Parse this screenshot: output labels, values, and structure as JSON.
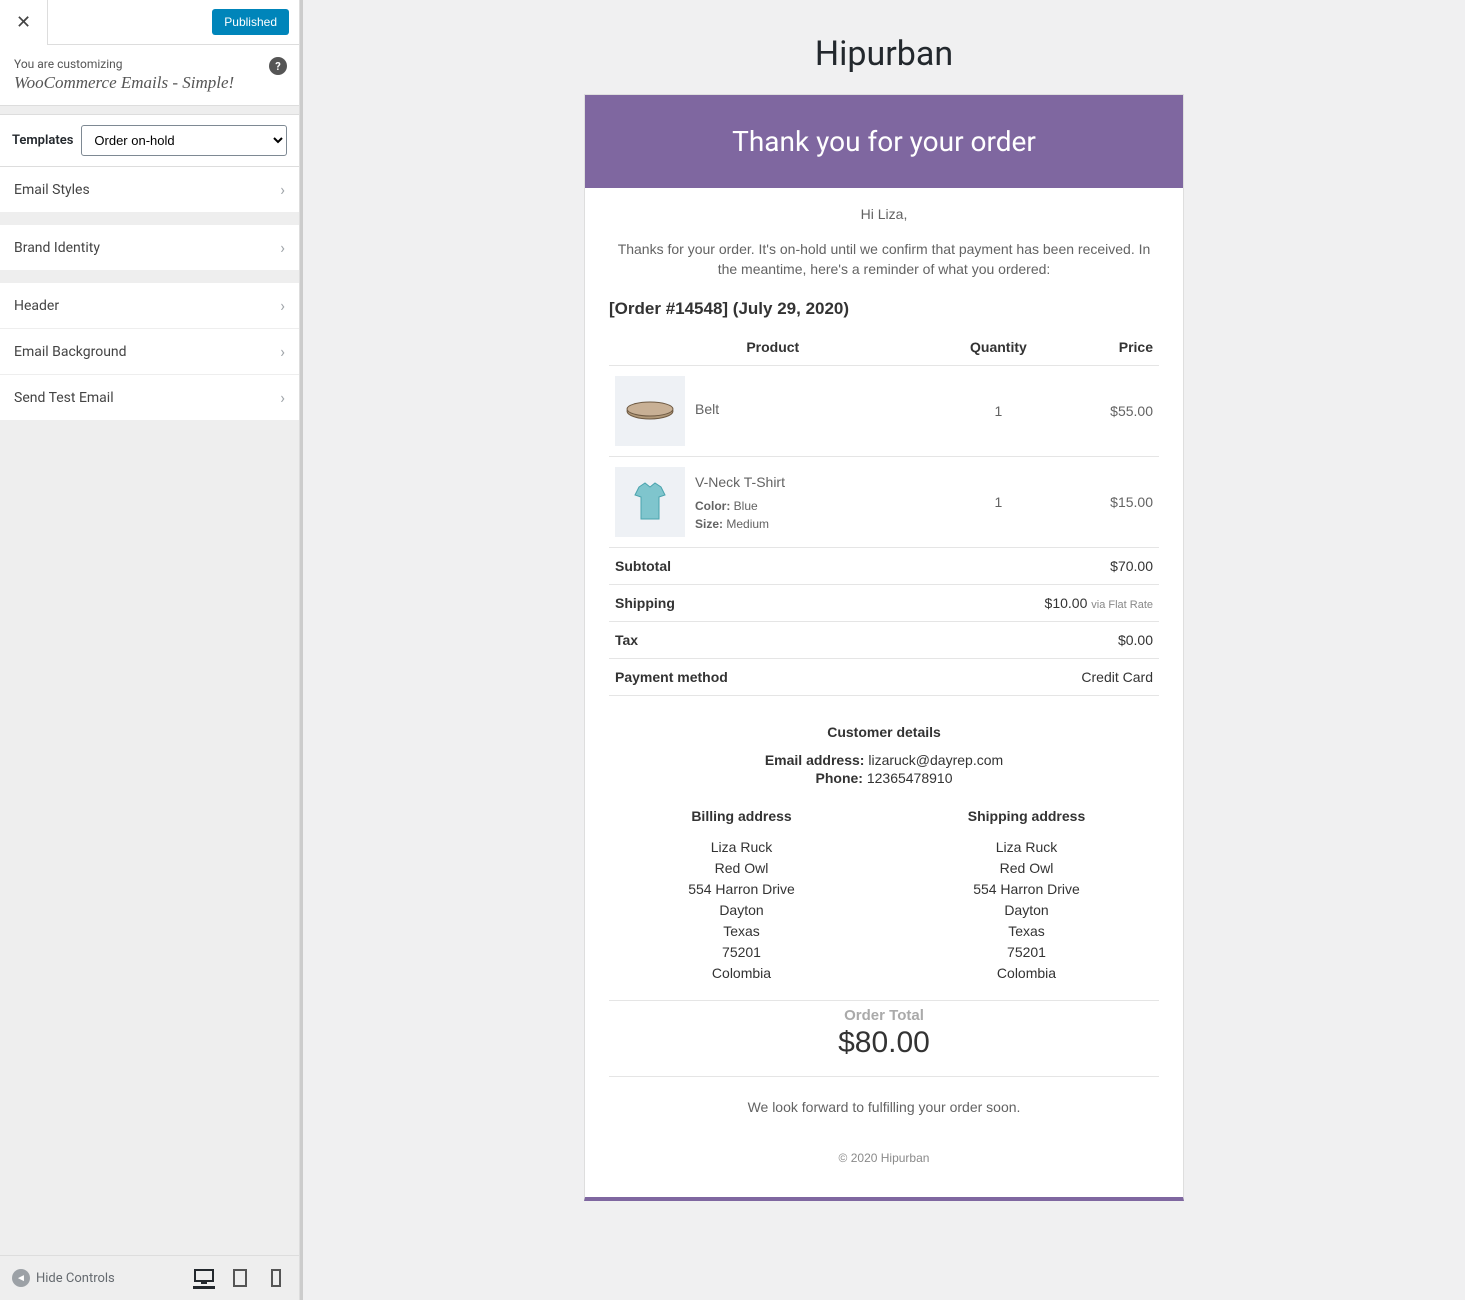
{
  "sidebar": {
    "published_label": "Published",
    "customizing_label": "You are customizing",
    "title": "WooCommerce Emails - Simple!",
    "templates_label": "Templates",
    "template_selected": "Order on-hold",
    "menu": [
      "Email Styles",
      "Brand Identity",
      "Header",
      "Email Background",
      "Send Test Email"
    ],
    "hide_controls": "Hide Controls"
  },
  "preview": {
    "brand": "Hipurban",
    "header": "Thank you for your order",
    "greeting": "Hi Liza,",
    "intro": "Thanks for your order. It's on-hold until we confirm that payment has been received. In the meantime, here's a reminder of what you ordered:",
    "order_number": "#14548",
    "order_date": "July 29, 2020",
    "columns": {
      "product": "Product",
      "quantity": "Quantity",
      "price": "Price"
    },
    "items": [
      {
        "name": "Belt",
        "qty": "1",
        "price": "$55.00",
        "attrs": []
      },
      {
        "name": "V-Neck T-Shirt",
        "qty": "1",
        "price": "$15.00",
        "attrs": [
          {
            "label": "Color:",
            "value": "Blue"
          },
          {
            "label": "Size:",
            "value": "Medium"
          }
        ]
      }
    ],
    "totals": [
      {
        "label": "Subtotal",
        "value": "$70.00",
        "sub": ""
      },
      {
        "label": "Shipping",
        "value": "$10.00",
        "sub": "via Flat Rate"
      },
      {
        "label": "Tax",
        "value": "$0.00",
        "sub": ""
      },
      {
        "label": "Payment method",
        "value": "Credit Card",
        "sub": ""
      }
    ],
    "customer_details_title": "Customer details",
    "email_label": "Email address:",
    "email_value": "lizaruck@dayrep.com",
    "phone_label": "Phone:",
    "phone_value": "12365478910",
    "billing_title": "Billing address",
    "shipping_title": "Shipping address",
    "address": [
      "Liza Ruck",
      "Red Owl",
      "554 Harron Drive",
      "Dayton",
      "Texas",
      "75201",
      "Colombia"
    ],
    "order_total_label": "Order Total",
    "order_total_value": "$80.00",
    "closing": "We look forward to fulfilling your order soon.",
    "footer": "© 2020 Hipurban"
  }
}
